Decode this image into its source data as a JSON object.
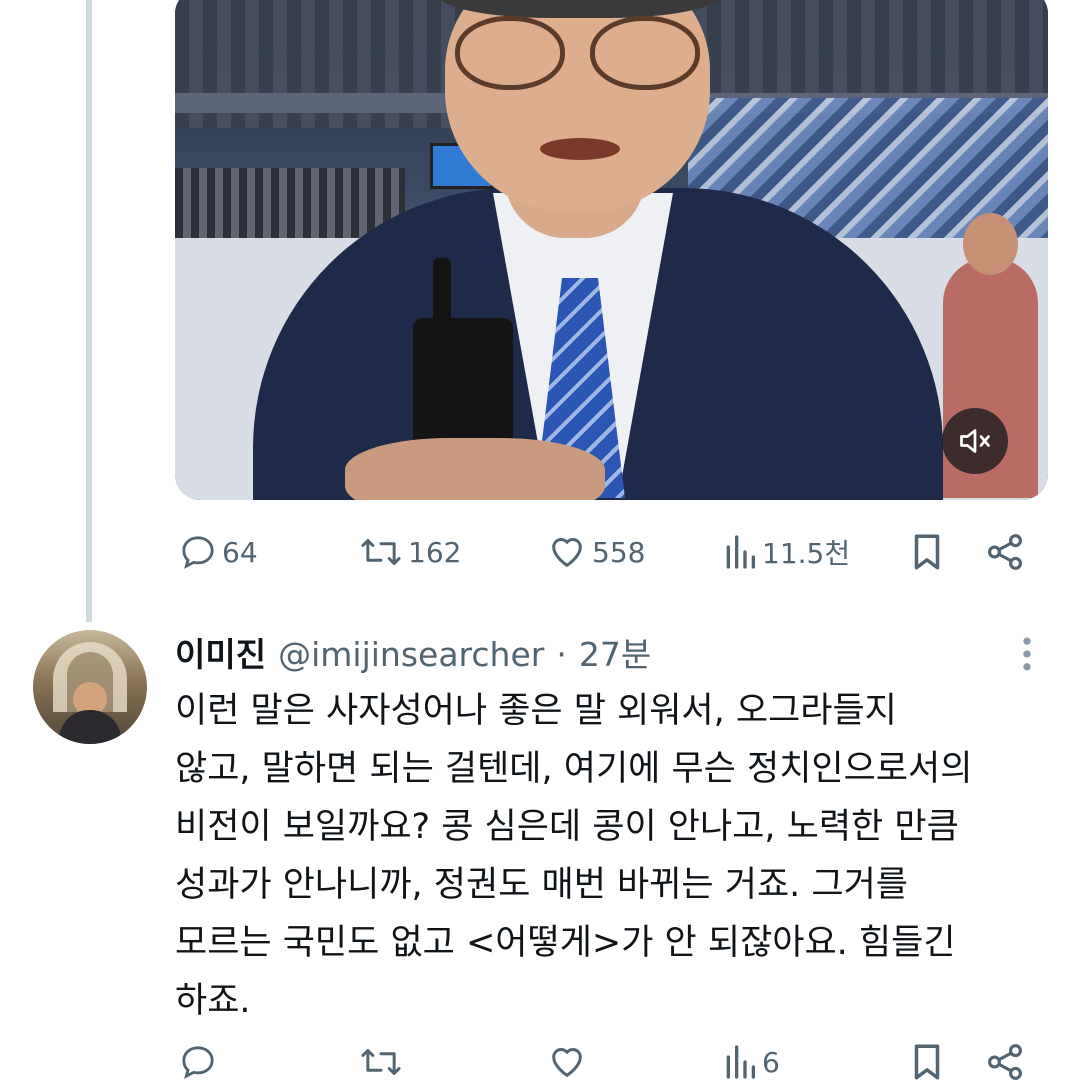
{
  "original_tweet": {
    "video": {
      "mute_icon": "speaker-muted-icon"
    },
    "stats": {
      "replies": "64",
      "retweets": "162",
      "likes": "558",
      "views": "11.5천"
    }
  },
  "reply_tweet": {
    "display_name": "이미진",
    "handle": "@imijinsearcher",
    "separator": "·",
    "time": "27분",
    "text_lines": [
      "이런 말은 사자성어나 좋은 말 외워서, 오그라들지",
      "않고, 말하면 되는 걸텐데, 여기에 무슨 정치인으로서의",
      "비전이 보일까요? 콩 심은데 콩이 안나고, 노력한 만큼",
      "성과가 안나니까, 정권도 매번 바뀌는 거죠. 그거를",
      "모르는 국민도 없고 <어떻게>가 안 되잖아요. 힘들긴",
      "하죠."
    ],
    "stats": {
      "replies": "",
      "retweets": "",
      "likes": "",
      "views": "6"
    }
  },
  "colors": {
    "text_primary": "#0f1419",
    "text_secondary": "#536471",
    "thread_line": "#cfd9de"
  }
}
